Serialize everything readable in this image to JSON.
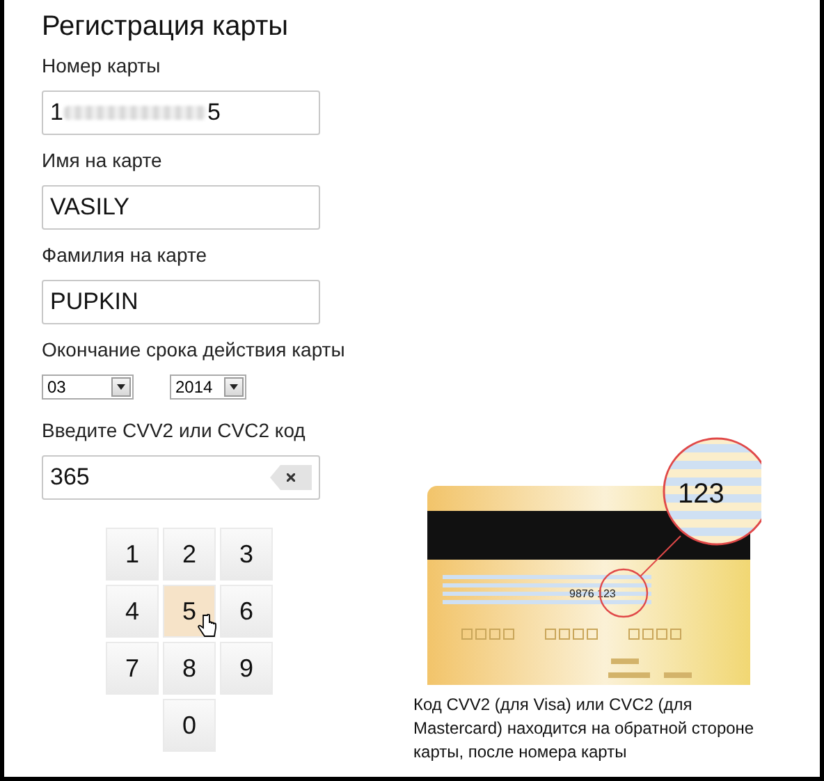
{
  "title": "Регистрация карты",
  "card_number": {
    "label": "Номер карты",
    "value_start": "1",
    "value_end": "5"
  },
  "first_name": {
    "label": "Имя на карте",
    "value": "VASILY"
  },
  "last_name": {
    "label": "Фамилия на карте",
    "value": "PUPKIN"
  },
  "expiry": {
    "label": "Окончание срока действия карты",
    "month": "03",
    "year": "2014"
  },
  "cvv": {
    "label": "Введите CVV2 или CVC2 код",
    "value": "365"
  },
  "keypad": [
    {
      "label": "1",
      "hovered": false
    },
    {
      "label": "2",
      "hovered": false
    },
    {
      "label": "3",
      "hovered": false
    },
    {
      "label": "4",
      "hovered": false
    },
    {
      "label": "5",
      "hovered": true
    },
    {
      "label": "6",
      "hovered": false
    },
    {
      "label": "7",
      "hovered": false
    },
    {
      "label": "8",
      "hovered": false
    },
    {
      "label": "9",
      "hovered": false
    },
    {
      "label": "0",
      "hovered": false
    }
  ],
  "card_illustration": {
    "strip_text": "9876 123",
    "zoom_text": "123"
  },
  "hint": "Код CVV2 (для Visa) или CVC2 (для Mastercard) находится на обратной стороне карты, после номера карты"
}
